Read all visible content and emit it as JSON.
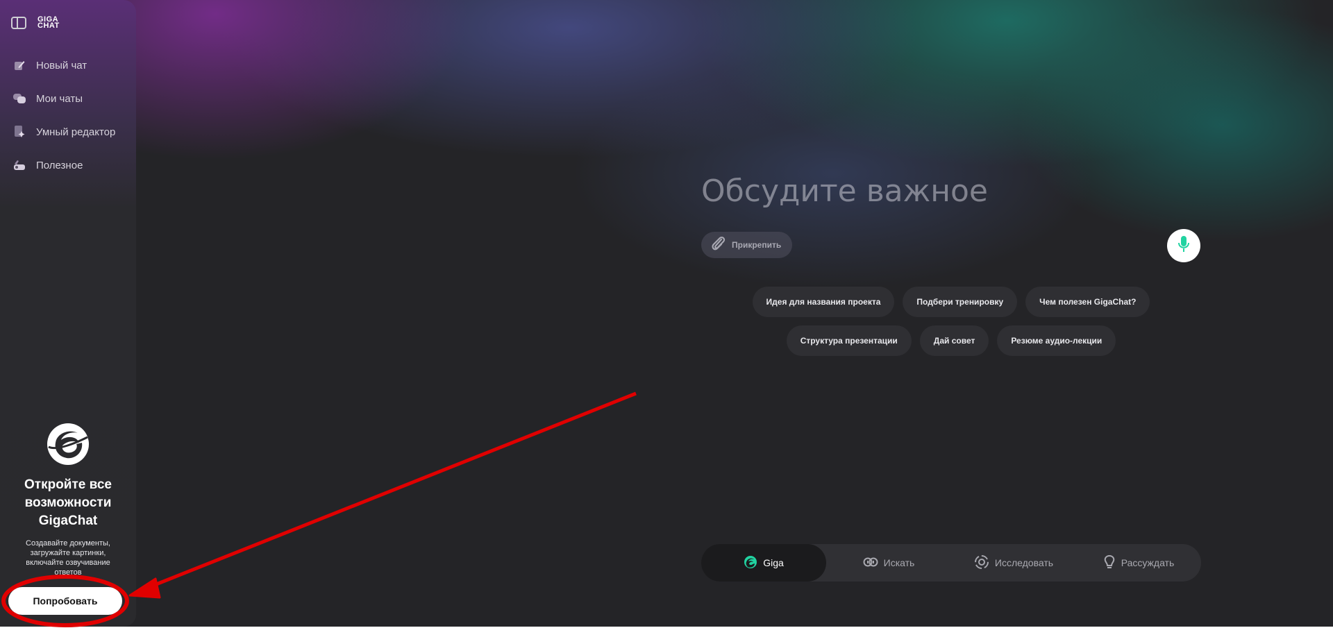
{
  "sidebar": {
    "logo_text": "GIGA CHAT",
    "nav": [
      {
        "label": "Новый чат",
        "icon": "edit-icon"
      },
      {
        "label": "Мои чаты",
        "icon": "chats-icon"
      },
      {
        "label": "Умный редактор",
        "icon": "smart-editor-icon"
      },
      {
        "label": "Полезное",
        "icon": "toolbox-icon"
      }
    ],
    "promo": {
      "title": "Откройте все возможности GigaChat",
      "text": "Создавайте документы, загружайте картинки, включайте озвучивание ответов",
      "button": "Попробовать"
    }
  },
  "main": {
    "prompt_placeholder": "Обсудите важное",
    "attach_label": "Прикрепить",
    "suggestions": [
      [
        "Идея для названия проекта",
        "Подбери тренировку",
        "Чем полезен GigaChat?"
      ],
      [
        "Структура презентации",
        "Дай совет",
        "Резюме аудио-лекции"
      ]
    ],
    "modes": [
      {
        "label": "Giga",
        "icon": "giga-logo-icon",
        "active": true
      },
      {
        "label": "Искать",
        "icon": "search-icon",
        "active": false
      },
      {
        "label": "Исследовать",
        "icon": "research-icon",
        "active": false
      },
      {
        "label": "Рассуждать",
        "icon": "lightbulb-icon",
        "active": false
      }
    ]
  },
  "colors": {
    "accent": "#21d3a1",
    "annotation": "#e00000",
    "background": "#242427"
  }
}
